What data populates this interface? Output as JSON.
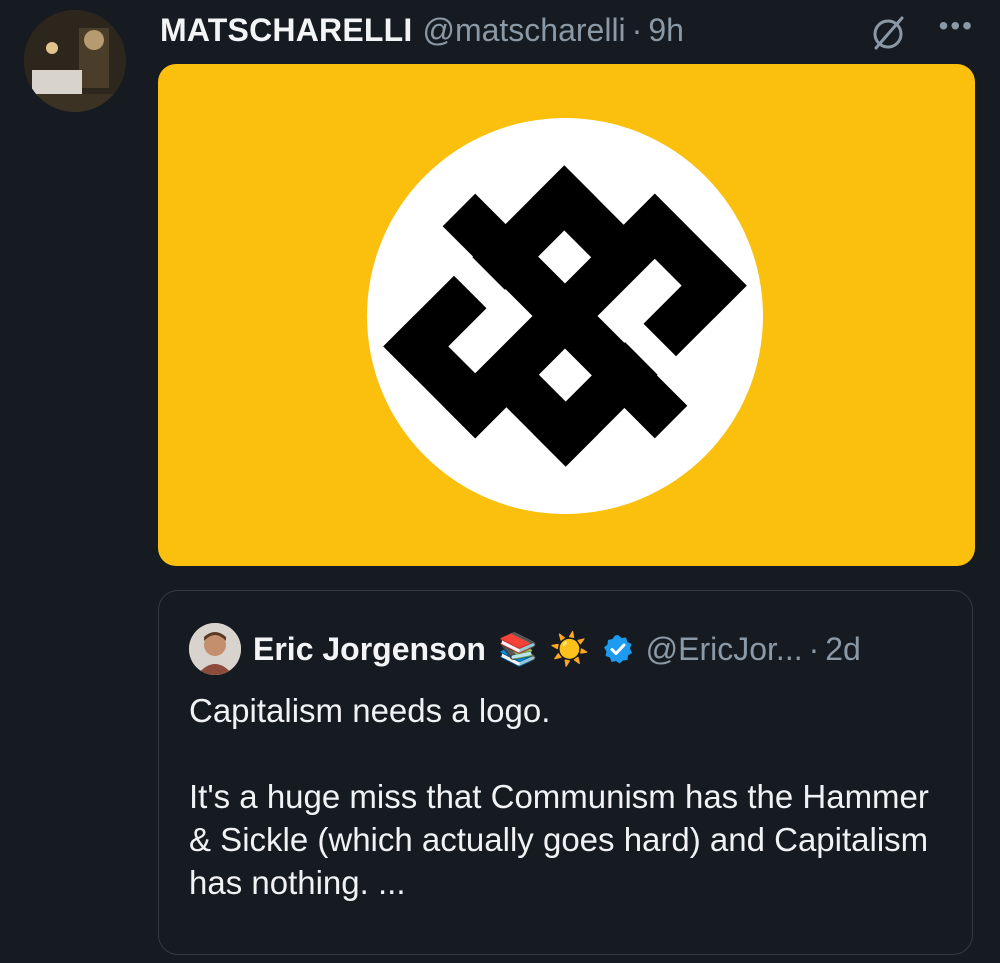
{
  "tweet": {
    "author_name": "MATSCHARELLI",
    "handle": "@matscharelli",
    "separator": "·",
    "time": "9h",
    "more_label": "•••"
  },
  "quoted": {
    "author_name": "Eric Jorgenson",
    "emoji1": "📚",
    "emoji2": "☀️",
    "handle": "@EricJor...",
    "separator": "·",
    "time": "2d",
    "text_line1": "Capitalism needs a logo.",
    "text_line2": "It's a huge miss that Communism has the Hammer & Sickle (which actually goes hard) and Capitalism has nothing. ..."
  },
  "colors": {
    "background": "#161b22",
    "flag_yellow": "#fbc00d",
    "verified_blue": "#1d9bf0",
    "muted_text": "#8b98a5"
  },
  "icons": [
    "grok-icon",
    "more-icon",
    "verified-badge-icon"
  ]
}
